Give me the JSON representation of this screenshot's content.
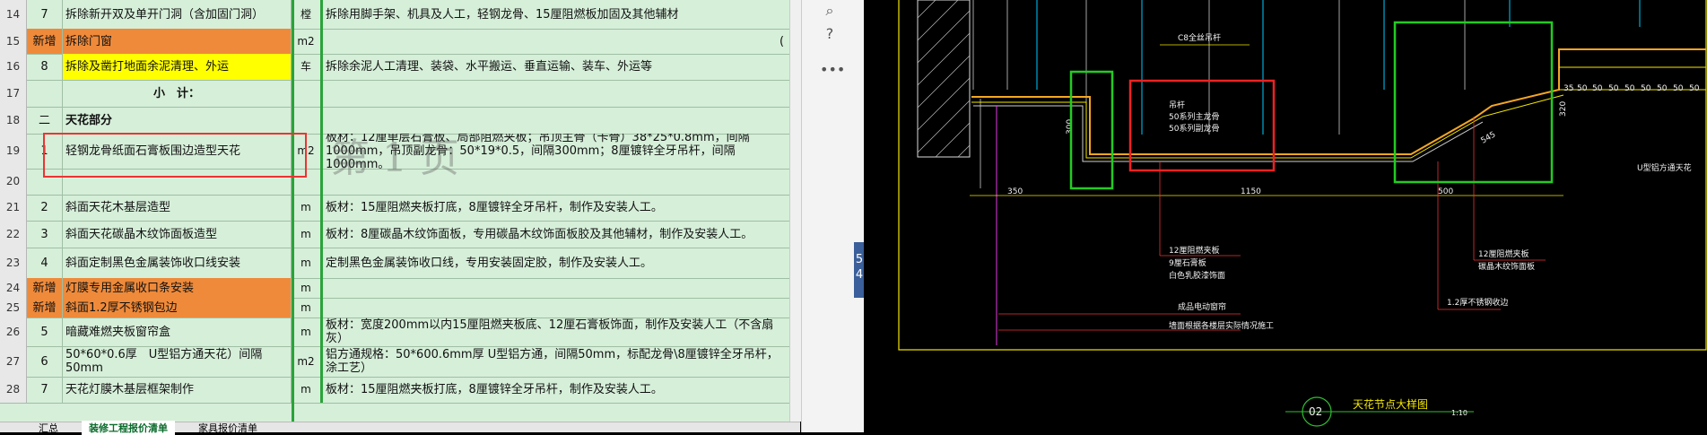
{
  "rows": [
    {
      "rn": "14",
      "a": "7",
      "b": "拆除新开双及单开门洞（含加固门洞）",
      "c": "樘",
      "d": "拆除用脚手架、机具及人工，轻钢龙骨、15厘阻燃板加固及其他辅材",
      "style": ""
    },
    {
      "rn": "15",
      "a": "新增",
      "b": "拆除门窗",
      "c": "m2",
      "d": "",
      "style": "orange",
      "d_tail": "("
    },
    {
      "rn": "16",
      "a": "8",
      "b": "拆除及凿打地面余泥清理、外运",
      "c": "车",
      "d": "拆除余泥人工清理、装袋、水平搬运、垂直运输、装车、外运等",
      "style": "yellow"
    },
    {
      "rn": "17",
      "a": "",
      "b": "小　计：",
      "c": "",
      "d": "",
      "style": "subtotal"
    },
    {
      "rn": "18",
      "a": "二",
      "b": "天花部分",
      "c": "",
      "d": "",
      "style": "bold"
    },
    {
      "rn": "19",
      "a": "1",
      "b": "轻钢龙骨纸面石膏板围边造型天花",
      "c": "m2",
      "d": "板材：12厘单层石膏板、局部阻燃夹板；吊顶主骨（卡骨）38*25*0.8mm，间隔1000mm，吊顶副龙骨：50*19*0.5，间隔300mm；8厘镀锌全牙吊杆，间隔1000mm。",
      "style": ""
    },
    {
      "rn": "20",
      "a": "",
      "b": "",
      "c": "",
      "d": "",
      "style": ""
    },
    {
      "rn": "21",
      "a": "2",
      "b": "斜面天花木基层造型",
      "c": "m",
      "d": "板材：15厘阻燃夹板打底，8厘镀锌全牙吊杆，制作及安装人工。",
      "style": ""
    },
    {
      "rn": "22",
      "a": "3",
      "b": "斜面天花碳晶木纹饰面板造型",
      "c": "m",
      "d": "板材：8厘碳晶木纹饰面板，专用碳晶木纹饰面板胶及其他辅材，制作及安装人工。",
      "style": ""
    },
    {
      "rn": "23",
      "a": "4",
      "b": "斜面定制黑色金属装饰收口线安装",
      "c": "m",
      "d": "定制黑色金属装饰收口线，专用安装固定胶，制作及安装人工。",
      "style": ""
    },
    {
      "rn": "24",
      "a": "新增",
      "b": "灯膜专用金属收口条安装",
      "c": "m",
      "d": "",
      "style": "orange"
    },
    {
      "rn": "25",
      "a": "新增",
      "b": "斜面1.2厚不锈钢包边",
      "c": "m",
      "d": "",
      "style": "orange"
    },
    {
      "rn": "26",
      "a": "5",
      "b": "暗藏难燃夹板窗帘盒",
      "c": "m",
      "d": "板材：宽度200mm以内15厘阻燃夹板底、12厘石膏板饰面，制作及安装人工（不含扇灰）",
      "style": ""
    },
    {
      "rn": "27",
      "a": "6",
      "b": "50*60*0.6厚　U型铝方通天花）间隔50mm",
      "c": "m2",
      "d": "铝方通规格：50*600.6mm厚 U型铝方通，间隔50mm，标配龙骨\\8厘镀锌全牙吊杆，涂工艺）",
      "style": ""
    },
    {
      "rn": "28",
      "a": "7",
      "b": "天花灯膜木基层框架制作",
      "c": "m",
      "d": "板材：15厘阻燃夹板打底，8厘镀锌全牙吊杆，制作及安装人工。",
      "style": ""
    }
  ],
  "watermark": "第 1 页",
  "tabs": [
    "汇总",
    "装修工程报价清单",
    "家具报价清单"
  ],
  "midpanel": {
    "icons": [
      "search-icon",
      "help-icon",
      "more-icon"
    ],
    "glyphs": [
      "⌕",
      "?",
      "•••"
    ],
    "blue_digits": [
      "5",
      "4"
    ]
  },
  "cad": {
    "labels": {
      "top": "C8全丝吊杆",
      "group1": [
        "吊杆",
        "50系列主龙骨",
        "50系列副龙骨"
      ],
      "dim_350": "350",
      "dim_1150": "1150",
      "dim_500": "500",
      "dim_320": "320",
      "dim_545": "545",
      "dim_300": "300",
      "aluminum": "U型铝方通天花",
      "notes_left": [
        "12厘阻燃夹板",
        "9厘石膏板",
        "白色乳胶漆饰面"
      ],
      "notes_right": [
        "12厘阻燃夹板",
        "碳晶木纹饰面板"
      ],
      "steel": "1.2厚不锈钢收边",
      "curtain": "成品电动窗帘",
      "wall": "墙面根据各楼层实际情况施工",
      "detail_no": "02",
      "detail_title": "天花节点大样图",
      "scale": "1:10",
      "strip_dims": [
        "35",
        "50",
        "50",
        "50",
        "50",
        "50",
        "50",
        "50",
        "50",
        "50"
      ]
    }
  }
}
